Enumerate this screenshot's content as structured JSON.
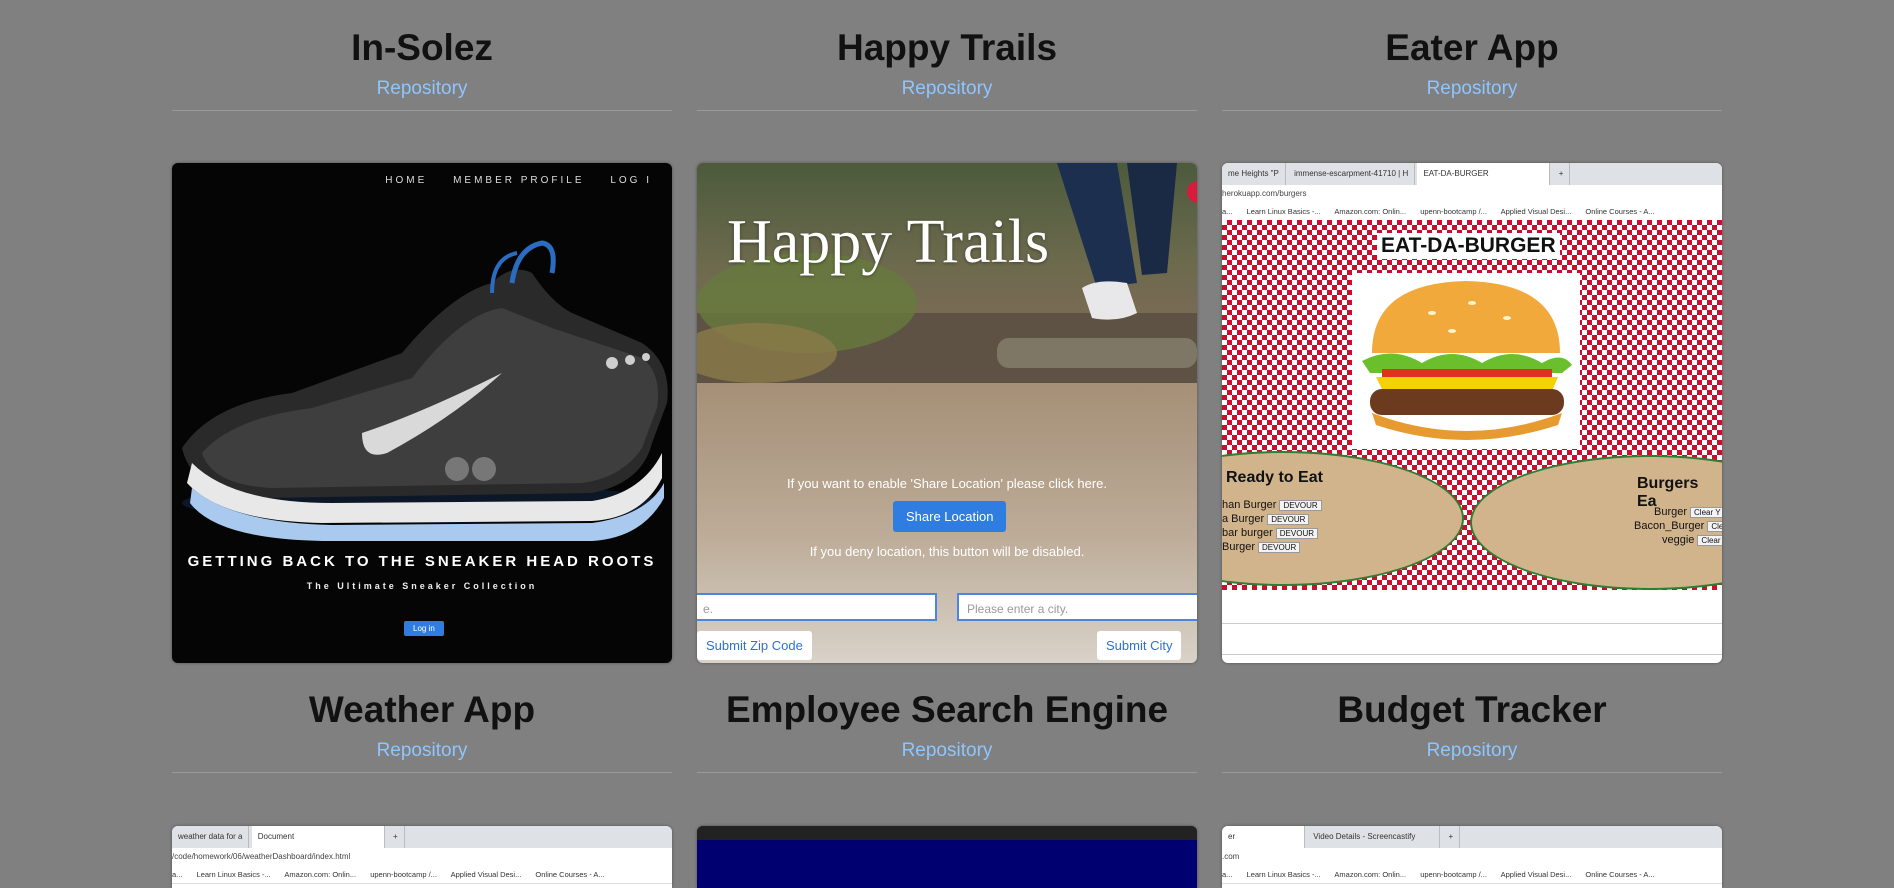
{
  "projects": [
    {
      "title": "In-Solez",
      "repo_label": "Repository",
      "screenshot": {
        "nav": [
          "HOME",
          "MEMBER PROFILE",
          "LOG I"
        ],
        "headline": "GETTING BACK TO THE SNEAKER HEAD ROOTS",
        "subheadline": "The Ultimate Sneaker Collection",
        "login_label": "Log in"
      }
    },
    {
      "title": "Happy Trails",
      "repo_label": "Repository",
      "screenshot": {
        "banner_title": "Happy Trails",
        "enable_msg": "If you want to enable 'Share Location' please click here.",
        "share_label": "Share Location",
        "deny_msg": "If you deny location, this button will be disabled.",
        "zip_placeholder": "e.",
        "city_placeholder": "Please enter a city.",
        "zip_button": "Submit Zip Code",
        "city_button": "Submit City"
      }
    },
    {
      "title": "Eater App",
      "repo_label": "Repository",
      "screenshot": {
        "tabs": [
          "me Heights \"P",
          "immense-escarpment-41710 | H",
          "EAT-DA-BURGER",
          "+"
        ],
        "url": "herokuapp.com/burgers",
        "bookmarks": [
          "a...",
          "Learn Linux Basics -...",
          "Amazon.com: Onlin...",
          "upenn-bootcamp /...",
          "Applied Visual Desi...",
          "Online Courses - A..."
        ],
        "heading": "EAT-DA-BURGER",
        "ready_title": "Ready to Eat",
        "ready_items": [
          "han Burger",
          "a Burger",
          "bar burger",
          "Burger"
        ],
        "devour_label": "DEVOUR",
        "eaten_title": "Burgers Ea",
        "eaten_items": [
          "Burger",
          "Bacon_Burger",
          "veggie"
        ],
        "clear_label": "Clear Y"
      }
    },
    {
      "title": "Weather App",
      "repo_label": "Repository",
      "screenshot": {
        "tabs": [
          "weather data for a",
          "Document",
          "+"
        ],
        "url": "/code/homework/06/weatherDashboard/index.html",
        "bookmarks": [
          "a...",
          "Learn Linux Basics -...",
          "Amazon.com: Onlin...",
          "upenn-bootcamp /...",
          "Applied Visual Desi...",
          "Online Courses - A..."
        ]
      }
    },
    {
      "title": "Employee Search Engine",
      "repo_label": "Repository"
    },
    {
      "title": "Budget Tracker",
      "repo_label": "Repository",
      "screenshot": {
        "tabs": [
          "er",
          "Video Details - Screencastify",
          "+"
        ],
        "url": ".com",
        "bookmarks": [
          "a...",
          "Learn Linux Basics -...",
          "Amazon.com: Onlin...",
          "upenn-bootcamp /...",
          "Applied Visual Desi...",
          "Online Courses - A..."
        ]
      }
    }
  ],
  "colors": {
    "page_background": "#808080",
    "link": "#8ec5ff",
    "primary_button": "#2f7de1"
  }
}
